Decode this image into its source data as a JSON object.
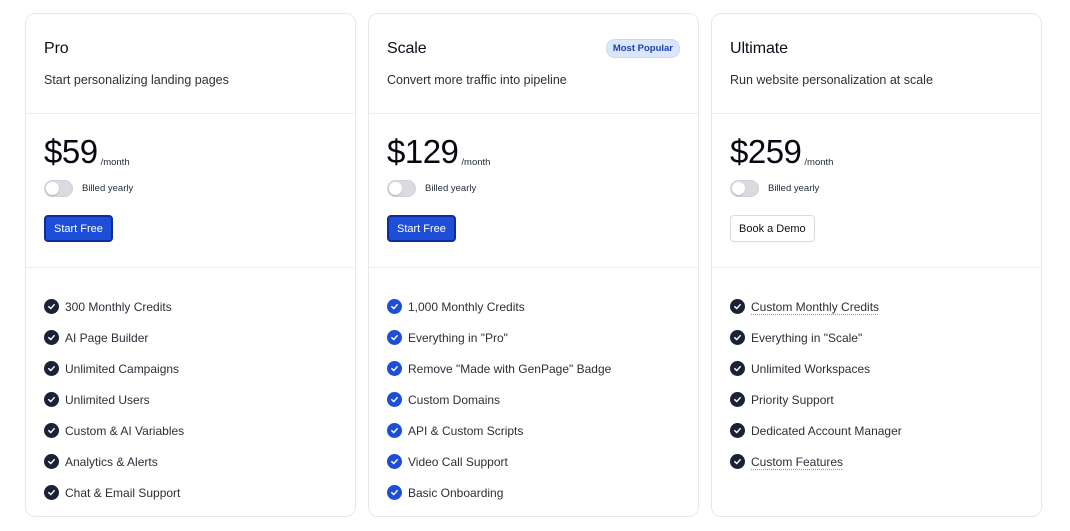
{
  "colors": {
    "primary_button": "#1d4ed8",
    "check_dark": "#1a2236",
    "check_blue": "#1d4ed8",
    "badge_bg": "#dbe6fb",
    "badge_text": "#1e40af"
  },
  "plans": [
    {
      "name": "Pro",
      "description": "Start personalizing landing pages",
      "price": "$59",
      "period": "/month",
      "billing_label": "Billed yearly",
      "billed_yearly_on": false,
      "cta_label": "Start Free",
      "cta_style": "primary",
      "check_color": "dark",
      "features": [
        {
          "text": "300 Monthly Credits",
          "underline": false
        },
        {
          "text": "AI Page Builder",
          "underline": false
        },
        {
          "text": "Unlimited Campaigns",
          "underline": false
        },
        {
          "text": "Unlimited Users",
          "underline": false
        },
        {
          "text": "Custom & AI Variables",
          "underline": false
        },
        {
          "text": "Analytics & Alerts",
          "underline": false
        },
        {
          "text": "Chat & Email Support",
          "underline": false
        }
      ]
    },
    {
      "name": "Scale",
      "badge": "Most Popular",
      "description": "Convert more traffic into pipeline",
      "price": "$129",
      "period": "/month",
      "billing_label": "Billed yearly",
      "billed_yearly_on": false,
      "cta_label": "Start Free",
      "cta_style": "primary",
      "check_color": "blue",
      "features": [
        {
          "text": "1,000 Monthly Credits",
          "underline": false
        },
        {
          "text": "Everything in \"Pro\"",
          "underline": false
        },
        {
          "text": "Remove \"Made with GenPage\" Badge",
          "underline": false
        },
        {
          "text": "Custom Domains",
          "underline": false
        },
        {
          "text": "API & Custom Scripts",
          "underline": false
        },
        {
          "text": "Video Call Support",
          "underline": false
        },
        {
          "text": "Basic Onboarding",
          "underline": false
        }
      ]
    },
    {
      "name": "Ultimate",
      "description": "Run website personalization at scale",
      "price": "$259",
      "period": "/month",
      "billing_label": "Billed yearly",
      "billed_yearly_on": false,
      "cta_label": "Book a Demo",
      "cta_style": "secondary",
      "check_color": "dark",
      "features": [
        {
          "text": "Custom Monthly Credits",
          "underline": true
        },
        {
          "text": "Everything in \"Scale\"",
          "underline": false
        },
        {
          "text": "Unlimited Workspaces",
          "underline": false
        },
        {
          "text": "Priority Support",
          "underline": false
        },
        {
          "text": "Dedicated Account Manager",
          "underline": false
        },
        {
          "text": "Custom Features",
          "underline": true
        }
      ]
    }
  ]
}
